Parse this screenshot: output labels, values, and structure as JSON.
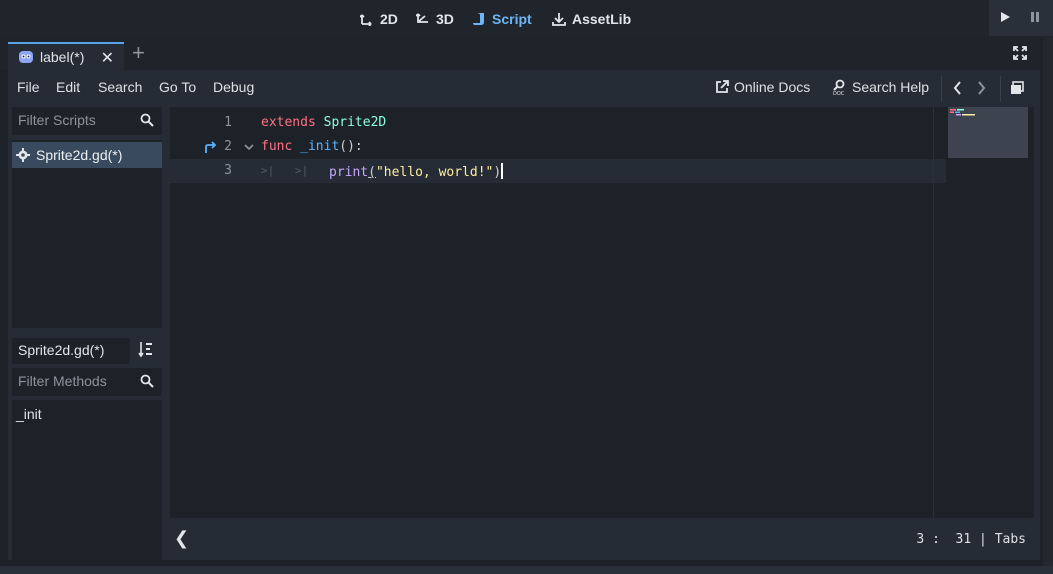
{
  "workspaces": [
    {
      "label": "2D",
      "icon": "2d-icon",
      "active": false
    },
    {
      "label": "3D",
      "icon": "3d-icon",
      "active": false
    },
    {
      "label": "Script",
      "icon": "script-icon",
      "active": true
    },
    {
      "label": "AssetLib",
      "icon": "assetlib-icon",
      "active": false
    }
  ],
  "scene_tabs": [
    {
      "label": "label(*)",
      "icon": "godot-scene-icon"
    }
  ],
  "menu": {
    "file": "File",
    "edit": "Edit",
    "search": "Search",
    "goto": "Go To",
    "debug": "Debug",
    "online_docs": "Online Docs",
    "search_help": "Search Help"
  },
  "script_panel": {
    "filter_placeholder": "Filter Scripts",
    "scripts": [
      {
        "label": "Sprite2d.gd(*)",
        "icon": "gear-icon",
        "selected": true
      }
    ],
    "current_script": "Sprite2d.gd(*)",
    "methods_filter_placeholder": "Filter Methods",
    "methods": [
      "_init"
    ]
  },
  "code": {
    "lines": [
      {
        "number": "1"
      },
      {
        "number": "2"
      },
      {
        "number": "3"
      }
    ],
    "tokens": {
      "extends": "extends",
      "base_class": "Sprite2D",
      "func": "func",
      "func_name": "_init",
      "func_sig": "():",
      "print": "print",
      "open_paren": "(",
      "string": "\"hello, world!\"",
      "close_paren": ")"
    }
  },
  "status": {
    "line": "3",
    "sep": ":",
    "column": "31",
    "pipe": "|",
    "indent": "Tabs"
  },
  "colors": {
    "keyword": "#ff7085",
    "type": "#8effda",
    "function": "#57b3ff",
    "builtin": "#c7a5ff",
    "string": "#ffeda1",
    "accent": "#6cb6f5"
  }
}
